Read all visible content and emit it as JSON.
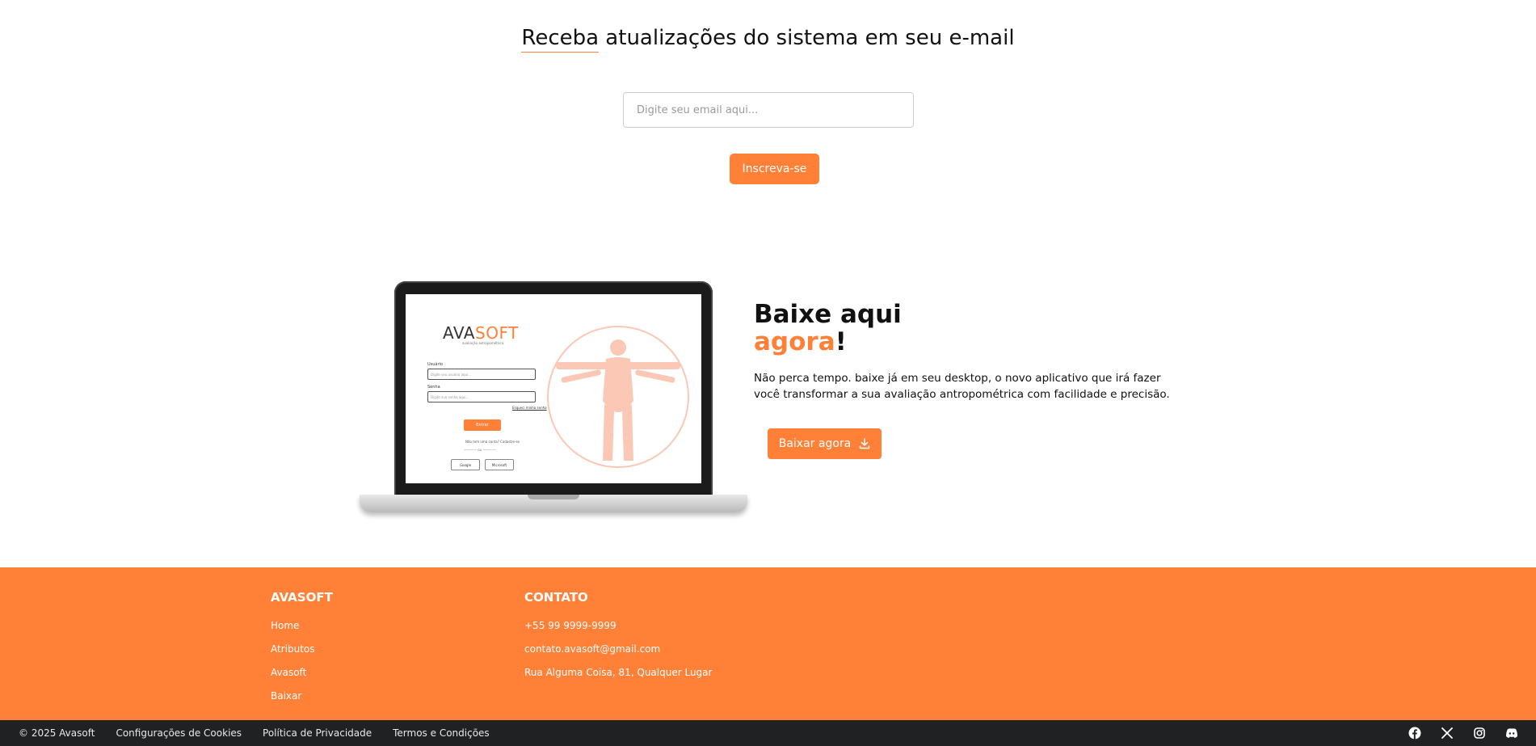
{
  "newsletter": {
    "title_highlight": "Receba",
    "title_rest": " atualizações do sistema em seu e-mail",
    "email_placeholder": "Digite seu email aqui...",
    "subscribe_label": "Inscreva-se"
  },
  "laptop_screen": {
    "logo_ava": "AVA",
    "logo_soft": "SOFT",
    "tagline": "avaliação antropométrica",
    "user_label": "Usuário",
    "user_placeholder": "Digite seu usuário aqui...",
    "password_label": "Senha",
    "password_placeholder": "Digite sua senha aqui...",
    "forgot_label": "Esqueci minha senha",
    "enter_label": "Entrar",
    "no_account": "Não tem uma conta? Cadastre-se",
    "or_label": "ou",
    "google_label": "Google",
    "microsoft_label": "Microsoft"
  },
  "download": {
    "heading_line1": "Baixe aqui",
    "heading_accent": "agora",
    "heading_exclaim": "!",
    "description": "Não perca tempo. baixe já em seu desktop, o novo aplicativo que irá fazer você transformar a sua avaliação antropométrica com facilidade e precisão.",
    "button_label": "Baixar agora"
  },
  "footer": {
    "col1": {
      "title": "AVASOFT",
      "items": [
        "Home",
        "Atributos",
        "Avasoft",
        "Baixar"
      ]
    },
    "col2": {
      "title": "CONTATO",
      "items": [
        "+55 99 9999-9999",
        "contato.avasoft@gmail.com",
        "Rua Alguma Coisa, 81, Qualquer Lugar"
      ]
    }
  },
  "bottom_bar": {
    "copyright": "© 2025 Avasoft",
    "links": [
      "Configurações de Cookies",
      "Política de Privacidade",
      "Termos e Condições"
    ],
    "socials": [
      "facebook-icon",
      "x-twitter-icon",
      "instagram-icon",
      "discord-icon"
    ]
  },
  "colors": {
    "accent": "#ff8036",
    "footer_bottom": "#1f2123"
  }
}
